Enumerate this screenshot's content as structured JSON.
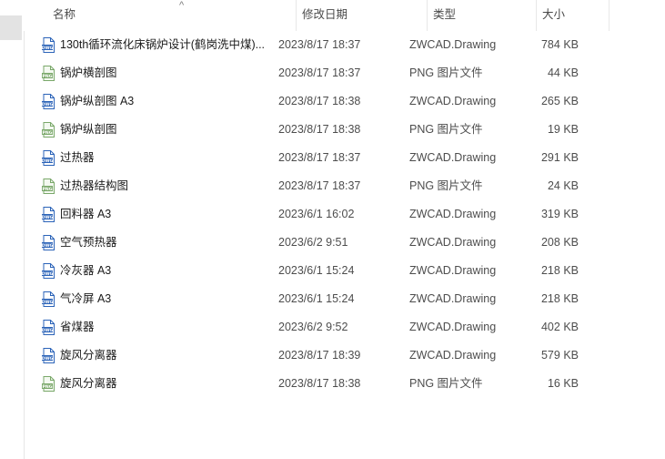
{
  "header": {
    "name_label": "名称",
    "date_label": "修改日期",
    "type_label": "类型",
    "size_label": "大小",
    "sort_indicator": "^"
  },
  "icons": {
    "dwg": "dwg-file-icon",
    "png": "png-file-icon"
  },
  "colors": {
    "dwg": "#2b63b8",
    "png": "#7aa86a"
  },
  "files": [
    {
      "name": "130th循环流化床锅炉设计(鹤岗洗中煤)...",
      "date": "2023/8/17 18:37",
      "type": "ZWCAD.Drawing",
      "size": "784 KB",
      "kind": "dwg"
    },
    {
      "name": "锅炉横剖图",
      "date": "2023/8/17 18:37",
      "type": "PNG 图片文件",
      "size": "44 KB",
      "kind": "png"
    },
    {
      "name": "锅炉纵剖图 A3",
      "date": "2023/8/17 18:38",
      "type": "ZWCAD.Drawing",
      "size": "265 KB",
      "kind": "dwg"
    },
    {
      "name": "锅炉纵剖图",
      "date": "2023/8/17 18:38",
      "type": "PNG 图片文件",
      "size": "19 KB",
      "kind": "png"
    },
    {
      "name": "过热器",
      "date": "2023/8/17 18:37",
      "type": "ZWCAD.Drawing",
      "size": "291 KB",
      "kind": "dwg"
    },
    {
      "name": "过热器结构图",
      "date": "2023/8/17 18:37",
      "type": "PNG 图片文件",
      "size": "24 KB",
      "kind": "png"
    },
    {
      "name": "回料器 A3",
      "date": "2023/6/1 16:02",
      "type": "ZWCAD.Drawing",
      "size": "319 KB",
      "kind": "dwg"
    },
    {
      "name": "空气预热器",
      "date": "2023/6/2 9:51",
      "type": "ZWCAD.Drawing",
      "size": "208 KB",
      "kind": "dwg"
    },
    {
      "name": "冷灰器 A3",
      "date": "2023/6/1 15:24",
      "type": "ZWCAD.Drawing",
      "size": "218 KB",
      "kind": "dwg"
    },
    {
      "name": "气冷屏 A3",
      "date": "2023/6/1 15:24",
      "type": "ZWCAD.Drawing",
      "size": "218 KB",
      "kind": "dwg"
    },
    {
      "name": "省煤器",
      "date": "2023/6/2 9:52",
      "type": "ZWCAD.Drawing",
      "size": "402 KB",
      "kind": "dwg"
    },
    {
      "name": "旋风分离器",
      "date": "2023/8/17 18:39",
      "type": "ZWCAD.Drawing",
      "size": "579 KB",
      "kind": "dwg"
    },
    {
      "name": "旋风分离器",
      "date": "2023/8/17 18:38",
      "type": "PNG 图片文件",
      "size": "16 KB",
      "kind": "png"
    }
  ]
}
